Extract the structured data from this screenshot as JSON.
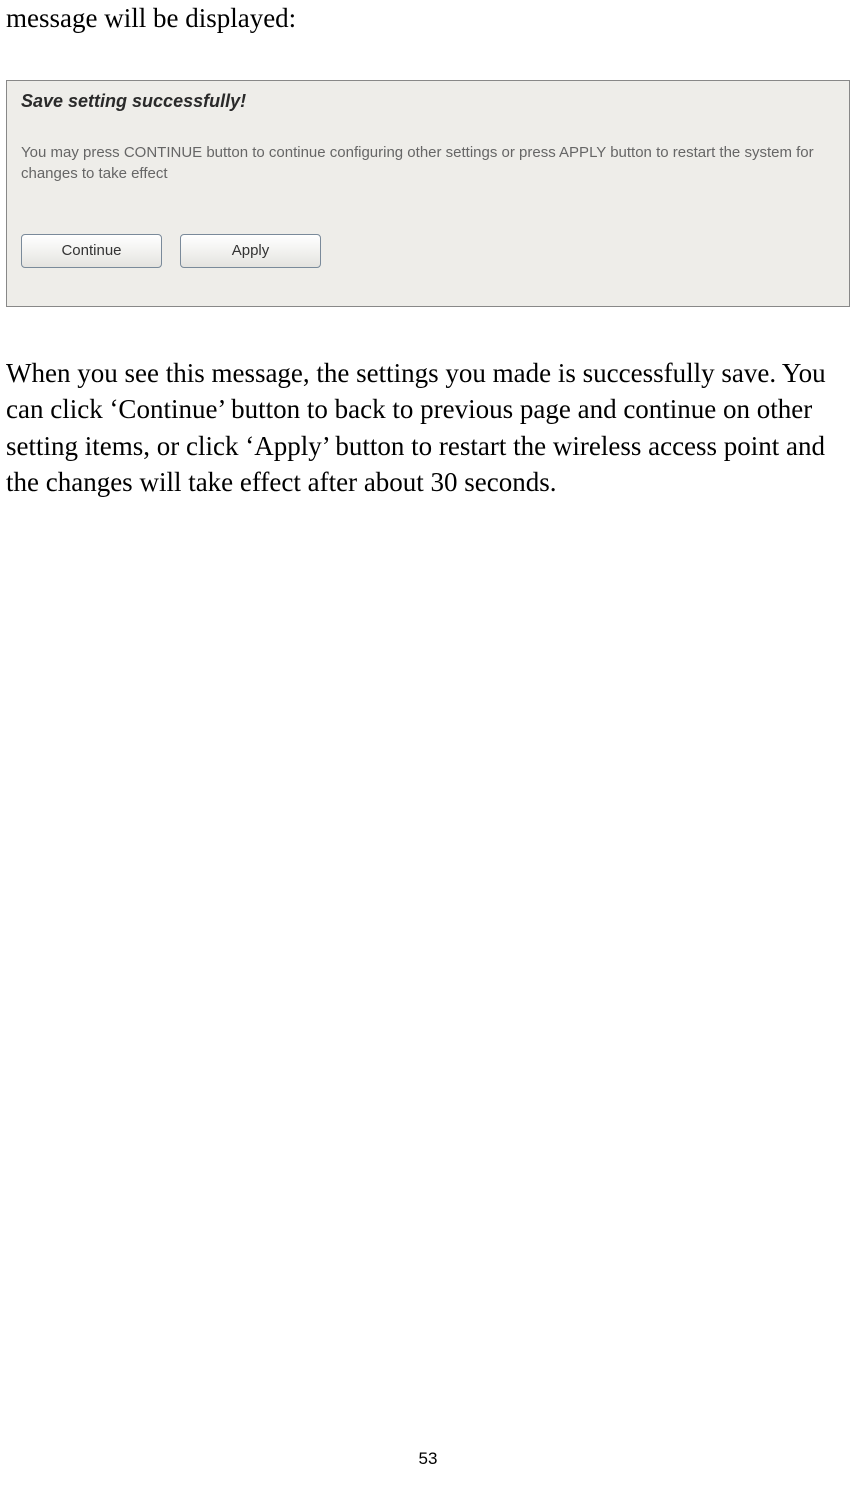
{
  "text_before": "message will be displayed:",
  "dialog": {
    "title": "Save setting successfully!",
    "description": "You may press CONTINUE button to continue configuring other settings or press APPLY button to restart the system for changes to take effect",
    "continue_label": "Continue",
    "apply_label": "Apply"
  },
  "text_after": "When you see this message, the settings you made is successfully save. You can click ‘Continue’ button to back to previous page and continue on other setting items, or click ‘Apply’ button to restart the wireless access point and the changes will take effect after about 30 seconds.",
  "page_number": "53"
}
